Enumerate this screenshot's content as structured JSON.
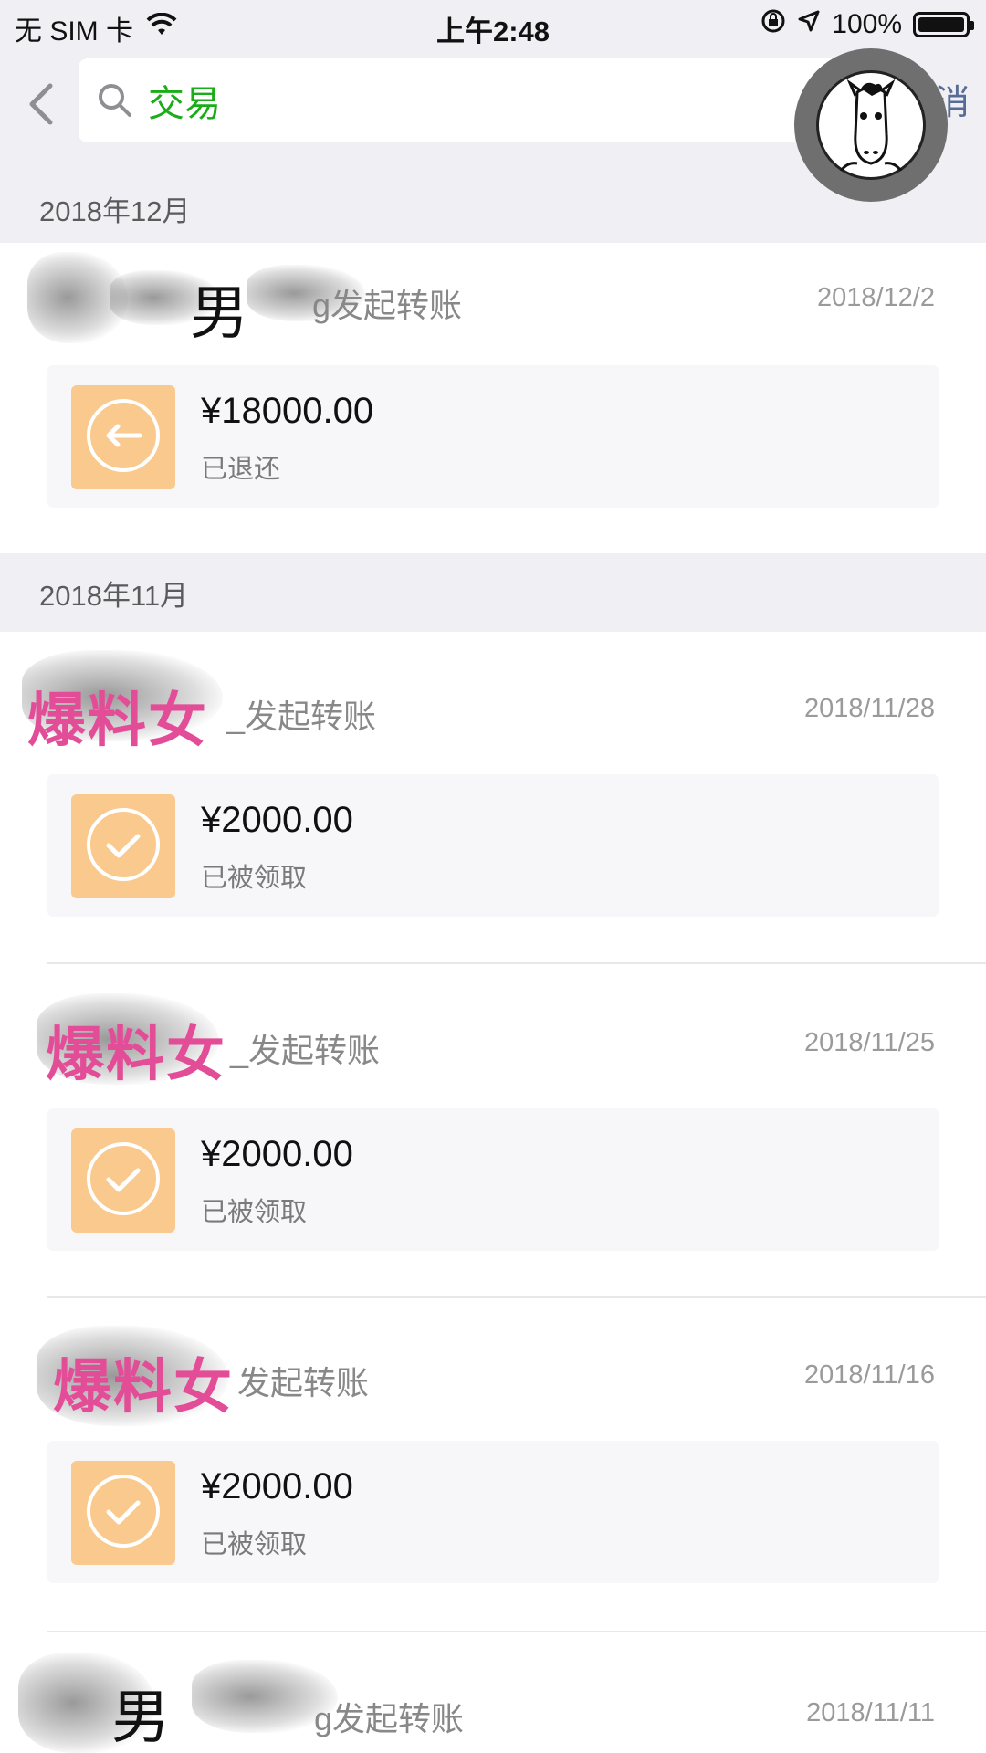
{
  "status_bar": {
    "carrier": "无 SIM 卡",
    "time": "上午2:48",
    "battery_text": "100%",
    "battery_level": 1.0
  },
  "nav": {
    "search_text": "交易",
    "cancel_label": "消"
  },
  "months": [
    {
      "label": "2018年12月",
      "transactions": [
        {
          "name": "男",
          "action": "g发起转账",
          "date": "2018/12/2",
          "amount": "¥18000.00",
          "status": "已退还",
          "icon": "return-arrow-icon"
        }
      ]
    },
    {
      "label": "2018年11月",
      "transactions": [
        {
          "name": "爆料女",
          "action": "_发起转账",
          "date": "2018/11/28",
          "amount": "¥2000.00",
          "status": "已被领取",
          "icon": "check-icon"
        },
        {
          "name": "爆料女",
          "action": "_发起转账",
          "date": "2018/11/25",
          "amount": "¥2000.00",
          "status": "已被领取",
          "icon": "check-icon"
        },
        {
          "name": "爆料女",
          "action": "发起转账",
          "date": "2018/11/16",
          "amount": "¥2000.00",
          "status": "已被领取",
          "icon": "check-icon"
        },
        {
          "name": "男",
          "action": "g发起转账",
          "date": "2018/11/11"
        }
      ]
    }
  ],
  "colors": {
    "background_gray": "#efeff4",
    "search_green": "#1aad19",
    "link_blue": "#576b95",
    "transfer_orange": "#f9c98e",
    "watermark_pink": "#e34d97"
  }
}
